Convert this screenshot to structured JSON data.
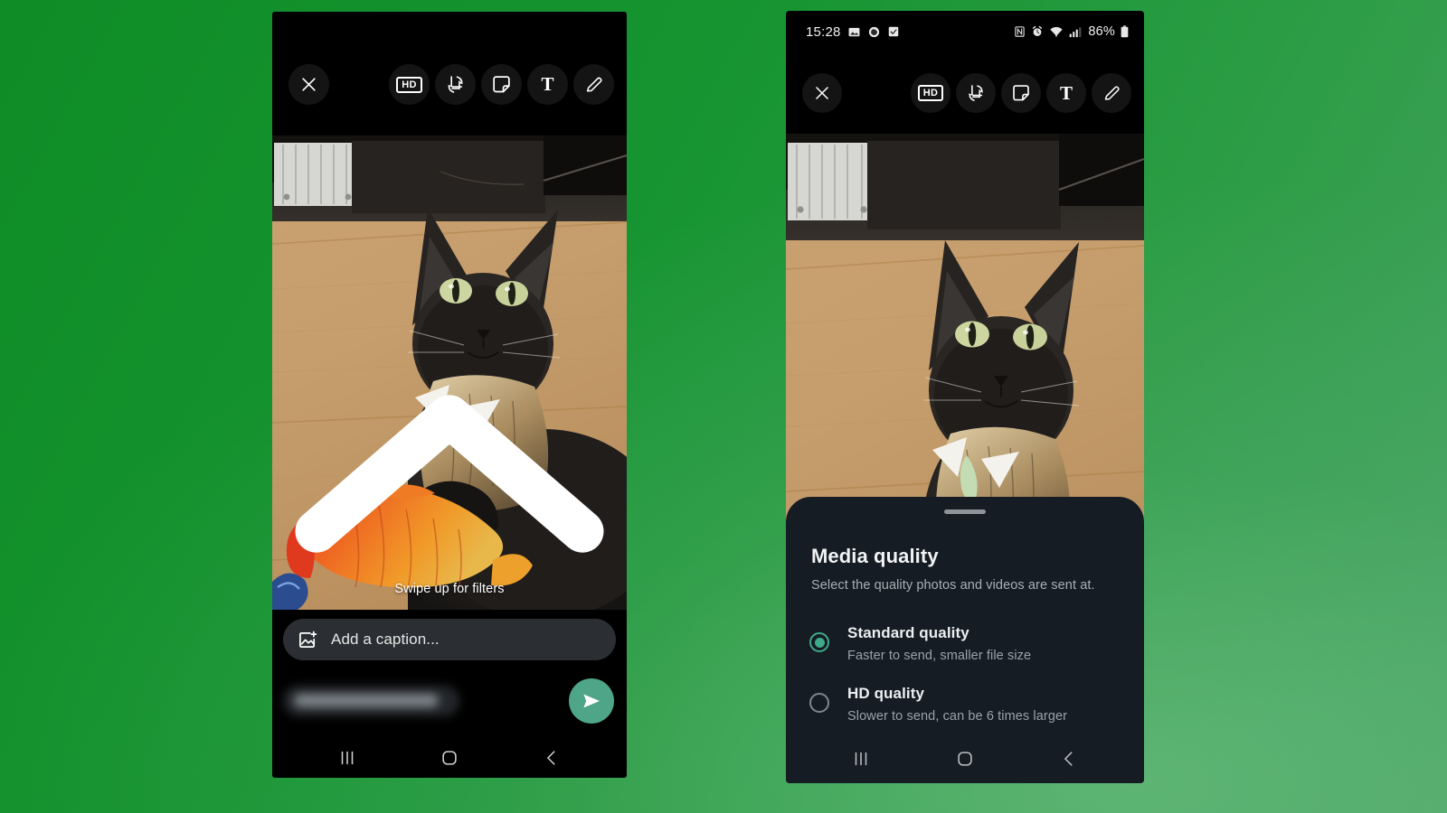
{
  "background": {
    "color_top_left": "#14922b",
    "color_bottom_right": "#4aa568"
  },
  "left_phone": {
    "toolbar": {
      "close_label": "close-icon",
      "buttons": [
        {
          "name": "hd-toggle",
          "label": "HD"
        },
        {
          "name": "crop-rotate",
          "label": "crop-rotate-icon"
        },
        {
          "name": "sticker",
          "label": "sticker-icon"
        },
        {
          "name": "text",
          "label": "T"
        },
        {
          "name": "draw",
          "label": "pencil-icon"
        }
      ]
    },
    "photo": {
      "alt": "Black long-haired cat lying on a wooden floor next to an orange plush fish toy",
      "swipe_hint": "Swipe up for filters"
    },
    "caption": {
      "placeholder": "Add a caption...",
      "icon": "add-photo-icon"
    },
    "send": {
      "recipient_chip": "",
      "send_icon": "send-icon",
      "send_color": "#4fa587"
    },
    "navbar": {
      "recents": "recents-icon",
      "home": "home-icon",
      "back": "back-icon"
    }
  },
  "right_phone": {
    "statusbar": {
      "time": "15:28",
      "left_icons": [
        "image-icon",
        "capture-icon",
        "checkbox-icon"
      ],
      "right_icons": [
        "nfc-icon",
        "alarm-icon",
        "wifi-icon",
        "signal-icon"
      ],
      "battery": "86%"
    },
    "toolbar": {
      "close_label": "close-icon",
      "buttons": [
        {
          "name": "hd-toggle",
          "label": "HD"
        },
        {
          "name": "crop-rotate",
          "label": "crop-rotate-icon"
        },
        {
          "name": "sticker",
          "label": "sticker-icon"
        },
        {
          "name": "text",
          "label": "T"
        },
        {
          "name": "draw",
          "label": "pencil-icon"
        }
      ]
    },
    "photo": {
      "alt": "Black long-haired cat lying on a wooden floor next to an orange plush fish toy"
    },
    "sheet": {
      "title": "Media quality",
      "subtitle": "Select the quality photos and videos are sent at.",
      "accent_color": "#3fa98a",
      "options": [
        {
          "title": "Standard quality",
          "description": "Faster to send, smaller file size",
          "selected": true
        },
        {
          "title": "HD quality",
          "description": "Slower to send, can be 6 times larger",
          "selected": false
        }
      ]
    },
    "navbar": {
      "recents": "recents-icon",
      "home": "home-icon",
      "back": "back-icon"
    }
  }
}
